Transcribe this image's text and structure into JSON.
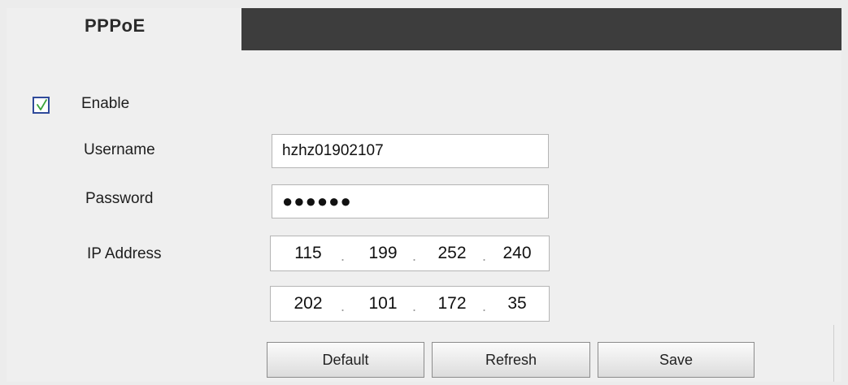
{
  "header": {
    "tab_title": "PPPoE"
  },
  "form": {
    "enable": {
      "label": "Enable",
      "checked": true
    },
    "username": {
      "label": "Username",
      "value": "hzhz01902107"
    },
    "password": {
      "label": "Password",
      "masked_value": "●●●●●●"
    },
    "ip_address": {
      "label": "IP Address",
      "rows": [
        {
          "octets": [
            "115",
            "199",
            "252",
            "240"
          ]
        },
        {
          "octets": [
            "202",
            "101",
            "172",
            "35"
          ]
        }
      ],
      "separator": "."
    }
  },
  "buttons": {
    "default_label": "Default",
    "refresh_label": "Refresh",
    "save_label": "Save"
  },
  "colors": {
    "tab_bar": "#3d3d3d",
    "background": "#efefef",
    "checkmark": "#3aa43a",
    "checkbox_border": "#2f4a9a"
  },
  "icons": {
    "checkbox_mark": "checkmark-icon"
  }
}
